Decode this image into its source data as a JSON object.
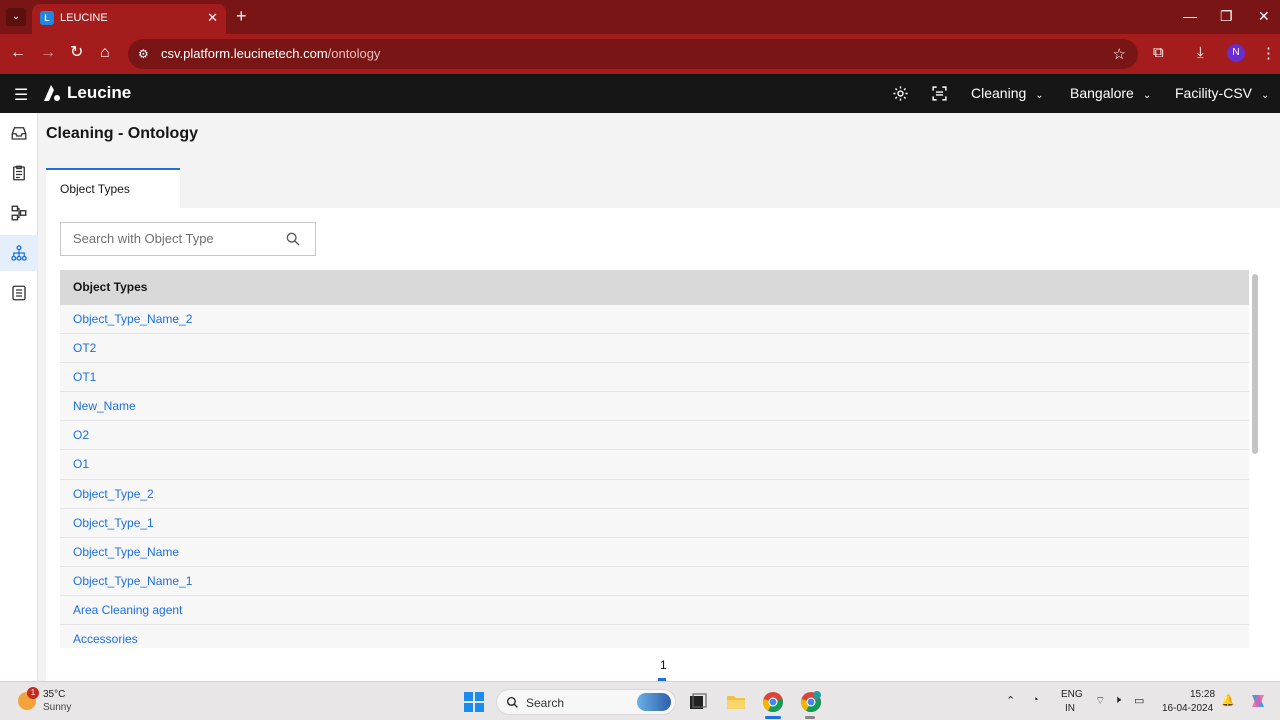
{
  "browser": {
    "tab_title": "LEUCINE",
    "url_domain": "csv.platform.leucinetech.com",
    "url_path": "/ontology",
    "profile_initial": "N"
  },
  "app": {
    "logo_text": "Leucine",
    "header": {
      "module": "Cleaning",
      "location": "Bangalore",
      "facility": "Facility-CSV"
    }
  },
  "page": {
    "title": "Cleaning - Ontology",
    "tab_label": "Object Types",
    "search_placeholder": "Search with Object Type",
    "table_header": "Object Types",
    "rows": [
      "Object_Type_Name_2",
      "OT2",
      "OT1",
      "New_Name",
      "O2",
      "O1",
      "Object_Type_2",
      "Object_Type_1",
      "Object_Type_Name",
      "Object_Type_Name_1",
      "Area Cleaning agent",
      "Accessories"
    ],
    "current_page": "1"
  },
  "taskbar": {
    "weather_temp": "35°C",
    "weather_desc": "Sunny",
    "weather_badge": "1",
    "search_label": "Search",
    "lang_line1": "ENG",
    "lang_line2": "IN",
    "time": "15:28",
    "date": "16-04-2024"
  },
  "colors": {
    "browser_frame": "#a41c1c",
    "app_header": "#161616",
    "link": "#1d6fe2"
  }
}
